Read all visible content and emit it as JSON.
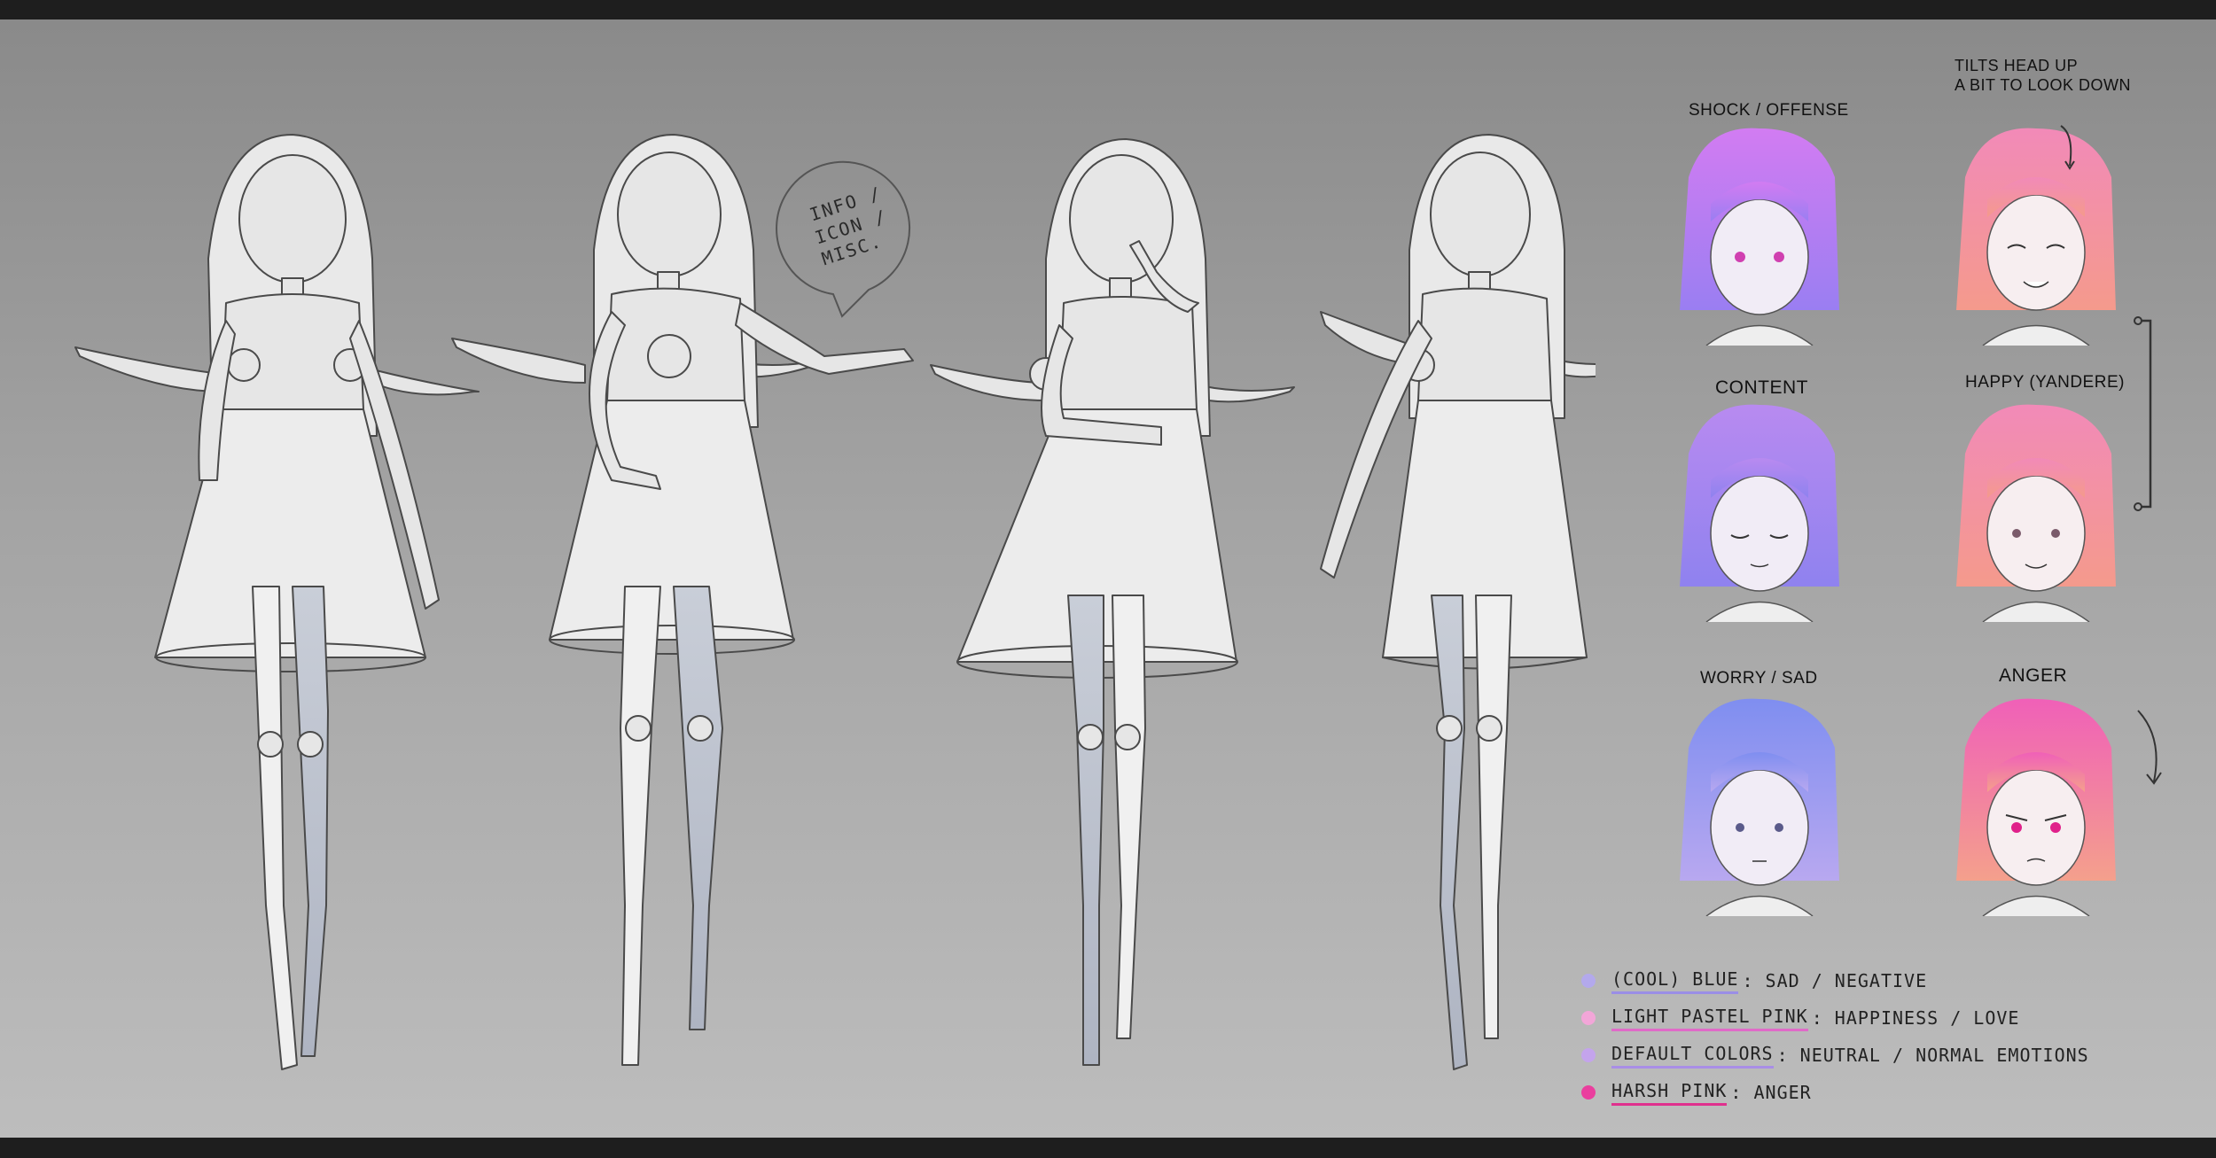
{
  "expressions": [
    {
      "label": "SHOCK / OFFENSE",
      "color_top": "#d27cf2",
      "color_bottom": "#9a7ef2"
    },
    {
      "label": "CONTENT",
      "color_top": "#b88af0",
      "color_bottom": "#8f82ef"
    },
    {
      "label": "WORRY / SAD",
      "color_top": "#7f8ef0",
      "color_bottom": "#b8a8f0"
    },
    {
      "label": "HAPPY (YANDERE)",
      "color_top": "#f28ab8",
      "color_bottom": "#f49a8c"
    },
    {
      "label": "ANGER",
      "color_top": "#f060b8",
      "color_bottom": "#f4a08c"
    }
  ],
  "happy_note_top": "TILTS HEAD UP",
  "happy_note_bottom": "A BIT TO LOOK DOWN",
  "speech_bubble": {
    "line1": "INFO /",
    "line2": "ICON /",
    "line3": "MISC."
  },
  "legend": [
    {
      "key": "(COOL) BLUE",
      "desc": ": SAD / NEGATIVE",
      "dot": "#b3a9ec",
      "underline": "#9a8ee6"
    },
    {
      "key": "LIGHT PASTEL PINK",
      "desc": ": HAPPINESS / LOVE",
      "dot": "#f2a6d8",
      "underline": "#e06ac8"
    },
    {
      "key": "DEFAULT COLORS",
      "desc": ": NEUTRAL / NORMAL EMOTIONS",
      "dot": "#c4a4ec",
      "underline": "#a98ee6"
    },
    {
      "key": "HARSH PINK",
      "desc": ": ANGER",
      "dot": "#ea3e9e",
      "underline": "#e0308e"
    }
  ]
}
